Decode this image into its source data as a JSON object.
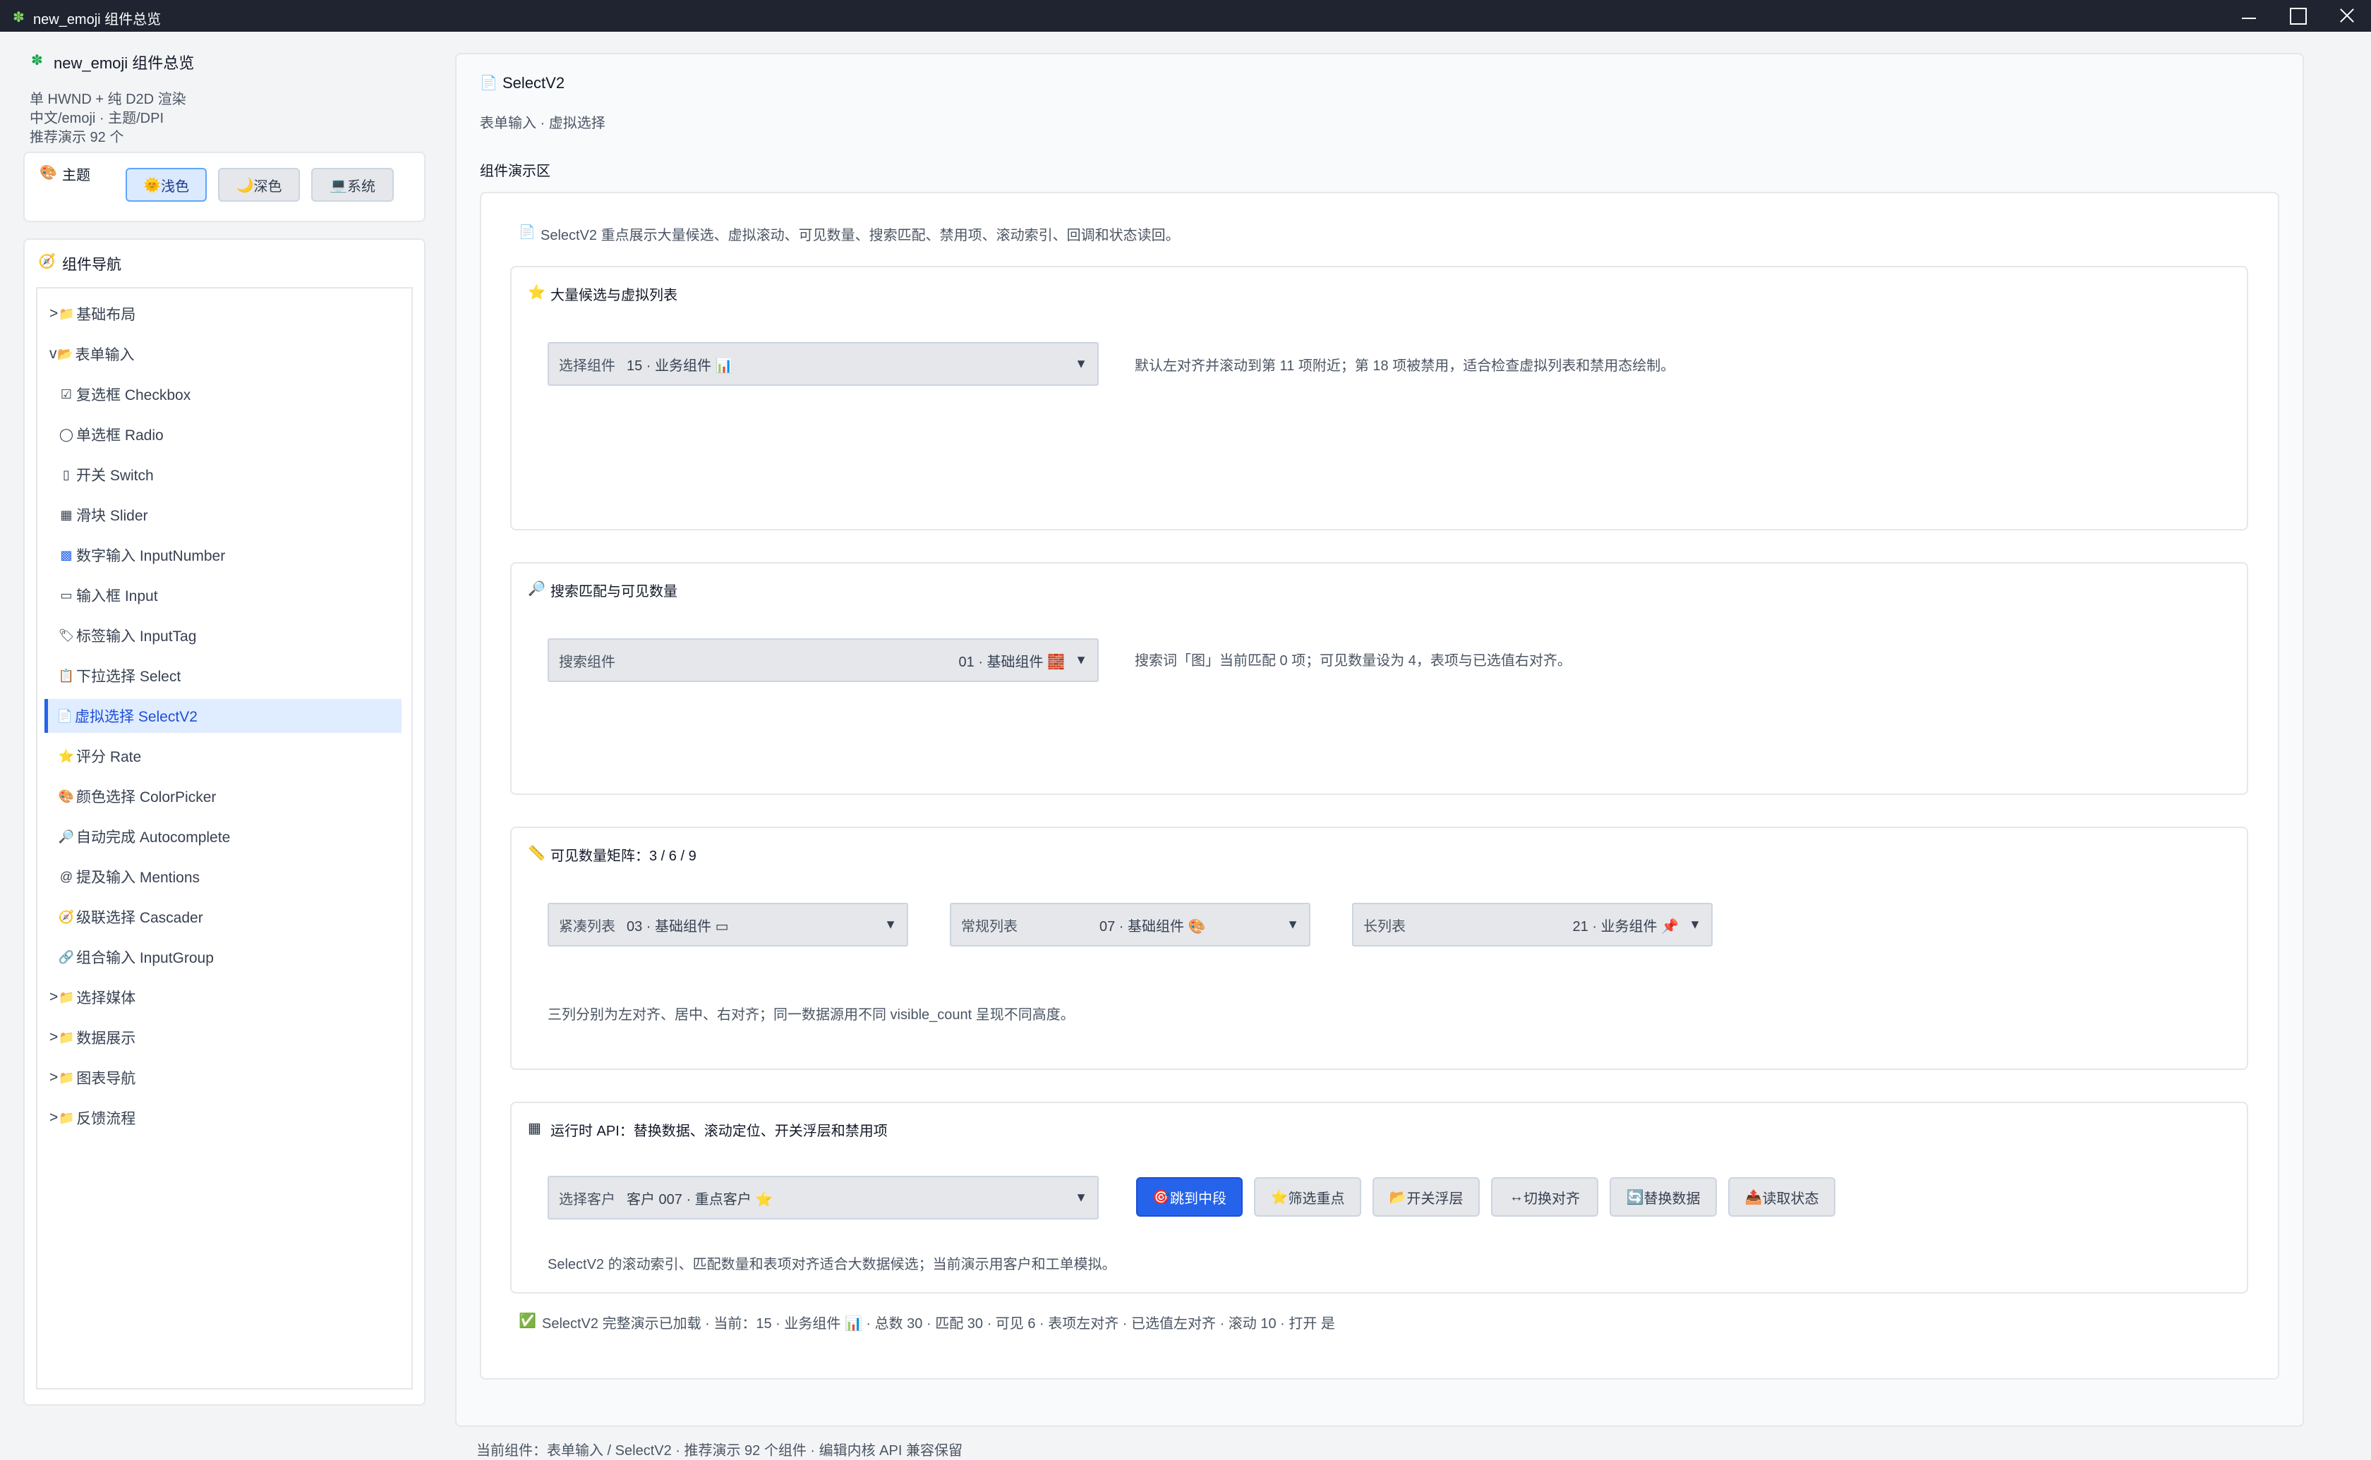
{
  "window": {
    "title": "new_emoji 组件总览"
  },
  "sidebar": {
    "app_title": "new_emoji 组件总览",
    "info_lines": [
      "单 HWND + 纯 D2D 渲染",
      "中文/emoji · 主题/DPI",
      "推荐演示 92 个"
    ],
    "theme": {
      "label": "主题",
      "buttons": [
        {
          "label": "浅色",
          "icon": "sun-icon",
          "active": true
        },
        {
          "label": "深色",
          "icon": "moon-icon",
          "active": false
        },
        {
          "label": "系统",
          "icon": "laptop-icon",
          "active": false
        }
      ]
    },
    "nav": {
      "title": "组件导航",
      "items": [
        {
          "label": "基础布局",
          "prefix": ">",
          "icon": "folder-icon"
        },
        {
          "label": "表单输入",
          "prefix": "v",
          "icon": "folder-icon"
        },
        {
          "label": "复选框 Checkbox",
          "icon": "checkbox-icon"
        },
        {
          "label": "单选框 Radio",
          "icon": "radio-icon"
        },
        {
          "label": "开关 Switch",
          "icon": "switch-icon"
        },
        {
          "label": "滑块 Slider",
          "icon": "slider-icon"
        },
        {
          "label": "数字输入 InputNumber",
          "icon": "number-icon"
        },
        {
          "label": "输入框 Input",
          "icon": "input-icon"
        },
        {
          "label": "标签输入 InputTag",
          "icon": "tag-icon"
        },
        {
          "label": "下拉选择 Select",
          "icon": "clipboard-icon"
        },
        {
          "label": "虚拟选择 SelectV2",
          "icon": "page-icon",
          "selected": true
        },
        {
          "label": "评分 Rate",
          "icon": "star-icon"
        },
        {
          "label": "颜色选择 ColorPicker",
          "icon": "palette-icon"
        },
        {
          "label": "自动完成 Autocomplete",
          "icon": "magnifier-icon"
        },
        {
          "label": "提及输入 Mentions",
          "icon": "at-icon"
        },
        {
          "label": "级联选择 Cascader",
          "icon": "compass-icon"
        },
        {
          "label": "组合输入 InputGroup",
          "icon": "link-icon"
        },
        {
          "label": "选择媒体",
          "prefix": ">",
          "icon": "folder-icon"
        },
        {
          "label": "数据展示",
          "prefix": ">",
          "icon": "folder-icon"
        },
        {
          "label": "图表导航",
          "prefix": ">",
          "icon": "folder-icon"
        },
        {
          "label": "反馈流程",
          "prefix": ">",
          "icon": "folder-icon"
        }
      ]
    }
  },
  "main": {
    "title": "SelectV2",
    "subtitle": "表单输入 · 虚拟选择",
    "demo_area_label": "组件演示区",
    "intro": "SelectV2 重点展示大量候选、虚拟滚动、可见数量、搜索匹配、禁用项、滚动索引、回调和状态读回。",
    "sections": {
      "s1": {
        "title": "大量候选与虚拟列表",
        "select_label": "选择组件",
        "select_value": "15 · 业务组件 📊",
        "note": "默认左对齐并滚动到第 11 项附近；第 18 项被禁用，适合检查虚拟列表和禁用态绘制。"
      },
      "s2": {
        "title": "搜索匹配与可见数量",
        "select_label": "搜索组件",
        "select_value": "01 · 基础组件 🧱",
        "note": "搜索词「图」当前匹配 0 项；可见数量设为 4，表项与已选值右对齐。"
      },
      "s3": {
        "title": "可见数量矩阵：3 / 6 / 9",
        "selects": [
          {
            "label": "紧凑列表",
            "value": "03 · 基础组件 ▭"
          },
          {
            "label": "常规列表",
            "value": "07 · 基础组件 🎨"
          },
          {
            "label": "长列表",
            "value": "21 · 业务组件 📌"
          }
        ],
        "note": "三列分别为左对齐、居中、右对齐；同一数据源用不同 visible_count 呈现不同高度。"
      },
      "s4": {
        "title": "运行时 API：替换数据、滚动定位、开关浮层和禁用项",
        "select_label": "选择客户",
        "select_value": "客户 007 · 重点客户 ⭐",
        "buttons": [
          {
            "label": "跳到中段",
            "icon": "target-icon",
            "primary": true
          },
          {
            "label": "筛选重点",
            "icon": "star-icon"
          },
          {
            "label": "开关浮层",
            "icon": "folder-icon"
          },
          {
            "label": "切换对齐",
            "icon": "align-icon"
          },
          {
            "label": "替换数据",
            "icon": "refresh-icon"
          },
          {
            "label": "读取状态",
            "icon": "inbox-icon"
          }
        ],
        "note": "SelectV2 的滚动索引、匹配数量和表项对齐适合大数据候选；当前演示用客户和工单模拟。"
      }
    },
    "status": "SelectV2 完整演示已加载 · 当前：15 · 业务组件 📊 · 总数 30 · 匹配 30 · 可见 6 · 表项左对齐 · 已选值左对齐 · 滚动 10 · 打开 是"
  },
  "statusbar": {
    "text": "当前组件：表单输入 / SelectV2 · 推荐演示 92 个组件 · 编辑内核 API 兼容保留"
  }
}
